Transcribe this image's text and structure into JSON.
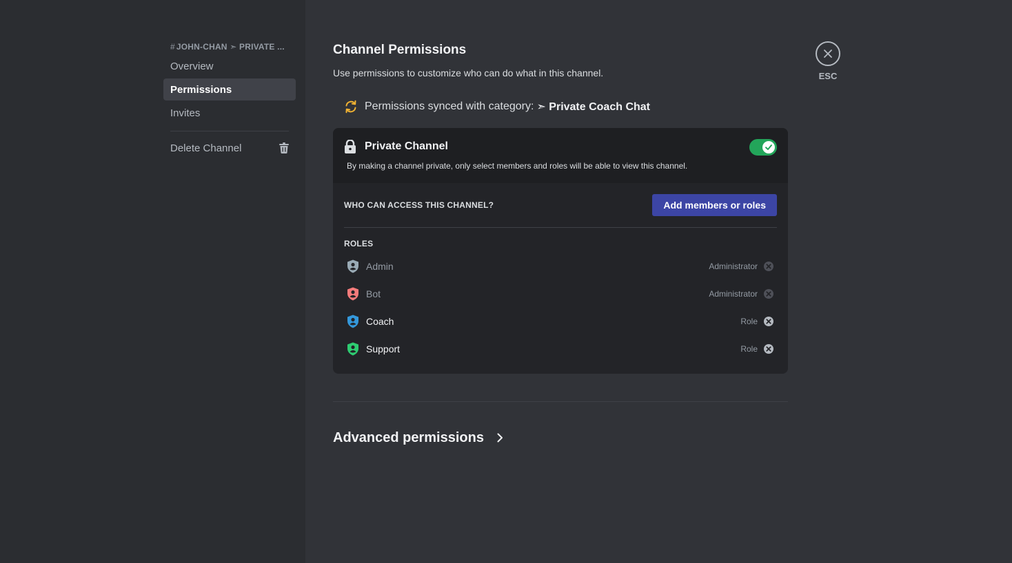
{
  "sidebar": {
    "header_prefix": "#",
    "header": "JOHN-CHAN ➣ PRIVATE ...",
    "items": [
      {
        "label": "Overview"
      },
      {
        "label": "Permissions"
      },
      {
        "label": "Invites"
      }
    ],
    "delete_label": "Delete Channel"
  },
  "main": {
    "title": "Channel Permissions",
    "subtitle": "Use permissions to customize who can do what in this channel.",
    "synced_text": "Permissions synced with category:",
    "synced_category": "➣ Private Coach Chat",
    "private_channel": {
      "title": "Private Channel",
      "description": "By making a channel private, only select members and roles will be able to view this channel.",
      "enabled": true
    },
    "access_label": "WHO CAN ACCESS THIS CHANNEL?",
    "add_button": "Add members or roles",
    "roles_label": "ROLES",
    "roles": [
      {
        "name": "Admin",
        "type": "Administrator",
        "color": "#99aab5"
      },
      {
        "name": "Bot",
        "type": "Administrator",
        "color": "#f47b7b"
      },
      {
        "name": "Coach",
        "type": "Role",
        "color": "#3498db"
      },
      {
        "name": "Support",
        "type": "Role",
        "color": "#2ecc71"
      }
    ],
    "advanced_label": "Advanced permissions"
  },
  "esc_label": "ESC",
  "colors": {
    "accent_button": "#3c45a5",
    "toggle_on": "#23a55a",
    "sync_icon": "#f0b232"
  }
}
